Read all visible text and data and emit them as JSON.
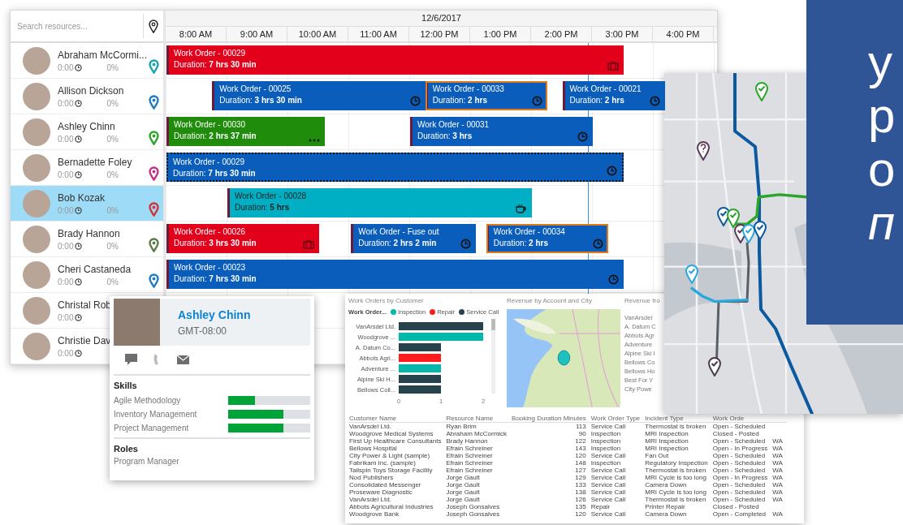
{
  "scheduler": {
    "search": {
      "placeholder": "Search resources..."
    },
    "date": "12/6/2017",
    "hours": [
      "8:00 AM",
      "9:00 AM",
      "10:00 AM",
      "11:00 AM",
      "12:00 PM",
      "1:00 PM",
      "2:00 PM",
      "3:00 PM",
      "4:00 PM"
    ],
    "resources": [
      {
        "name": "Abraham McCormi...",
        "hours": "0:00",
        "percent": "0%",
        "color": "#1aa3b5",
        "selected": false
      },
      {
        "name": "Allison Dickson",
        "hours": "0:00",
        "percent": "0%",
        "color": "#1e7bc4",
        "selected": false
      },
      {
        "name": "Ashley Chinn",
        "hours": "0:00",
        "percent": "0%",
        "color": "#2aa52a",
        "selected": false
      },
      {
        "name": "Bernadette Foley",
        "hours": "0:00",
        "percent": "0%",
        "color": "#c0328a",
        "selected": false
      },
      {
        "name": "Bob Kozak",
        "hours": "0:00",
        "percent": "0%",
        "color": "#d13438",
        "selected": true
      },
      {
        "name": "Brady Hannon",
        "hours": "0:00",
        "percent": "0%",
        "color": "#5a7a4a",
        "selected": false
      },
      {
        "name": "Cheri Castaneda",
        "hours": "0:00",
        "percent": "0%",
        "color": "#1e7bc4",
        "selected": false
      },
      {
        "name": "Christal Rob",
        "hours": "0:00",
        "selected": false
      },
      {
        "name": "Christie Dav",
        "hours": "0:00",
        "selected": false
      }
    ],
    "bookings": [
      [
        {
          "title": "Work Order - 00029",
          "label": "Duration:",
          "duration": "7 hrs 30 min",
          "color": "#e3001b",
          "kind": "break",
          "outlined": false,
          "selected": false
        }
      ],
      [
        {
          "title": "Work Order - 00025",
          "label": "Duration:",
          "duration": "3 hrs 30 min",
          "color": "#0a5dbb",
          "kind": "scheduled",
          "outlined": false,
          "selected": false
        },
        {
          "title": "Work Order - 00033",
          "label": "Duration:",
          "duration": "2 hrs",
          "color": "#0a5dbb",
          "kind": "scheduled",
          "outlined": true,
          "selected": false
        },
        {
          "title": "Work Order - 00021",
          "label": "Duration:",
          "duration": "2 hrs",
          "color": "#0a5dbb",
          "kind": "scheduled",
          "outlined": false,
          "selected": false
        }
      ],
      [
        {
          "title": "Work Order - 00030",
          "label": "Duration:",
          "duration": "2 hrs 37 min",
          "color": "#1f8c0c",
          "kind": "progress",
          "outlined": false,
          "selected": false
        },
        {
          "title": "Work Order - 00031",
          "label": "Duration:",
          "duration": "3 hrs",
          "color": "#0a5dbb",
          "kind": "scheduled",
          "outlined": false,
          "selected": false
        }
      ],
      [
        {
          "title": "Work Order - 00029",
          "label": "Duration:",
          "duration": "7 hrs 30 min",
          "color": "#0a5dbb",
          "kind": "scheduled",
          "outlined": false,
          "selected": true
        }
      ],
      [
        {
          "title": "Work Order - 00028",
          "label": "Duration:",
          "duration": "5 hrs",
          "color": "#00afc4",
          "kind": "pause",
          "outlined": false,
          "selected": false
        }
      ],
      [
        {
          "title": "Work Order - 00026",
          "label": "Duration:",
          "duration": "3 hrs 30 min",
          "color": "#e3001b",
          "kind": "break",
          "outlined": false,
          "selected": false
        },
        {
          "title": "Work Order - Fuse out",
          "label": "Duration:",
          "duration": "2 hrs 2 min",
          "color": "#0a5dbb",
          "kind": "scheduled",
          "outlined": false,
          "selected": false
        },
        {
          "title": "Work Order - 00034",
          "label": "Duration:",
          "duration": "2 hrs",
          "color": "#0a5dbb",
          "kind": "scheduled",
          "outlined": true,
          "selected": false
        }
      ],
      [
        {
          "title": "Work Order - 00023",
          "label": "Duration:",
          "duration": "7 hrs 30 min",
          "color": "#0a5dbb",
          "kind": "scheduled",
          "outlined": false,
          "selected": false
        }
      ]
    ]
  },
  "profile": {
    "name": "Ashley Chinn",
    "timezone": "GMT-08:00",
    "skills_heading": "Skills",
    "skills": [
      {
        "name": "Agile Methodology",
        "level": 0.33
      },
      {
        "name": "Inventory Management",
        "level": 0.67
      },
      {
        "name": "Project Management",
        "level": 0.67
      }
    ],
    "roles_heading": "Roles",
    "roles": [
      "Program Manager"
    ]
  },
  "report": {
    "bar_panel": {
      "legend_title": "Work Order...",
      "chart_data": {
        "type": "bar",
        "orientation": "horizontal",
        "title": "Work Orders by Customer",
        "categories": [
          "VanArsdel Ltd.",
          "Woodgrove ...",
          "A. Datum Co...",
          "Abbots Agri...",
          "Adventure ...",
          "Alpine Ski H...",
          "Bellows Coll..."
        ],
        "series": [
          {
            "name": "Inspection",
            "color": "#01b8aa",
            "values": [
              null,
              2,
              null,
              null,
              1,
              null,
              null
            ]
          },
          {
            "name": "Repair",
            "color": "#fd1d1d",
            "values": [
              null,
              null,
              null,
              1,
              null,
              null,
              null
            ]
          },
          {
            "name": "Service Call",
            "color": "#26424d",
            "values": [
              2,
              null,
              1,
              null,
              null,
              1,
              1
            ]
          }
        ],
        "xlim": [
          0,
          2
        ],
        "xticks": [
          0,
          1,
          2
        ]
      }
    },
    "map_panel": {
      "title": "Revenue by Account and City"
    },
    "list_panel": {
      "title": "Revenue fro",
      "items": [
        "VanArsdel",
        "A. Datum C",
        "Abbots Agr",
        "Adventure",
        "Alpine Ski I",
        "Bellows Co",
        "Bellows Ho",
        "Best For Y",
        "City Powe"
      ]
    },
    "table": {
      "columns": [
        "Customer Name",
        "Resource Name",
        "Booking Duration Minutes",
        "Work Order Type",
        "Incident Type",
        "Work Orde"
      ],
      "rows": [
        [
          "VanArsdel Ltd.",
          "Ryan Brim",
          "113",
          "Service Call",
          "Thermostat is broken",
          "Open - Scheduled",
          ""
        ],
        [
          "Woodgrove Medical Systems",
          "Abraham McCormick",
          "90",
          "Inspection",
          "MRI Inspection",
          "Closed - Posted",
          ""
        ],
        [
          "First Up Healthcare Consultants",
          "Brady Hannon",
          "122",
          "Inspection",
          "MRI Inspection",
          "Open - Scheduled",
          "WA"
        ],
        [
          "Bellows Hospital",
          "Efrain Schreiner",
          "143",
          "Inspection",
          "MRI Inspection",
          "Open - In Progress",
          "WA"
        ],
        [
          "City Power & Light (sample)",
          "Efrain Schreiner",
          "120",
          "Service Call",
          "Fan Out",
          "Open - Scheduled",
          "WA"
        ],
        [
          "Fabrikam Inc. (sample)",
          "Efrain Schreiner",
          "148",
          "Inspection",
          "Regulatory Inspection",
          "Open - Scheduled",
          "WA"
        ],
        [
          "Tailspin Toys Storage Facility",
          "Efrain Schreiner",
          "127",
          "Service Call",
          "Thermostat is broken",
          "Open - Scheduled",
          "WA"
        ],
        [
          "Nod Publishers",
          "Jorge Gault",
          "129",
          "Service Call",
          "MRI Cycle is too long",
          "Open - In Progress",
          "WA"
        ],
        [
          "Consolidated Messenger",
          "Jorge Gault",
          "133",
          "Service Call",
          "Camera Down",
          "Open - Scheduled",
          "WA"
        ],
        [
          "Proseware Diagnostic",
          "Jorge Gault",
          "138",
          "Service Call",
          "MRI Cycle is too long",
          "Open - Scheduled",
          "WA"
        ],
        [
          "VanArsdel Ltd.",
          "Jorge Gault",
          "126",
          "Service Call",
          "Thermostat is broken",
          "Open - Scheduled",
          "WA"
        ],
        [
          "Abbots Agricultural Industries",
          "Joseph Gonsalves",
          "135",
          "Repair",
          "Printer Repair",
          "Closed - Posted",
          ""
        ],
        [
          "Woodgrove Bank",
          "Joseph Gonsalves",
          "120",
          "Service Call",
          "Camera Down",
          "Open - Completed",
          "WA"
        ]
      ]
    }
  },
  "slide_panel": {
    "lines": [
      {
        "text": "у",
        "kind": "regular"
      },
      {
        "text": "р",
        "kind": "regular"
      },
      {
        "text": "о",
        "kind": "regular"
      },
      {
        "text": "п",
        "kind": "italic"
      }
    ]
  }
}
